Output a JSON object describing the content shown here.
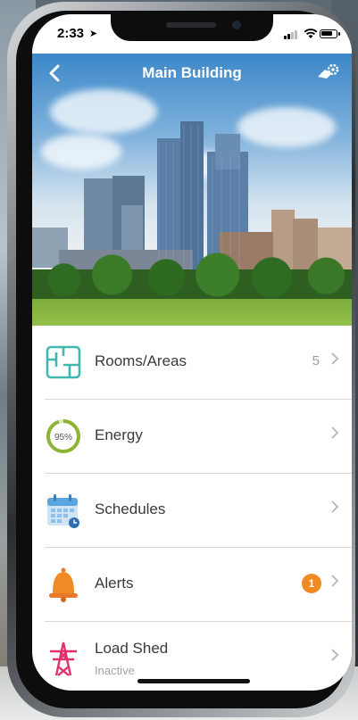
{
  "status_bar": {
    "time": "2:33"
  },
  "header": {
    "title": "Main Building"
  },
  "menu": [
    {
      "id": "rooms",
      "label": "Rooms/Areas",
      "count": "5",
      "icon": "floorplan-icon"
    },
    {
      "id": "energy",
      "label": "Energy",
      "gauge_text": "95%",
      "gauge_value": 95,
      "icon": "energy-gauge-icon"
    },
    {
      "id": "schedules",
      "label": "Schedules",
      "icon": "calendar-icon"
    },
    {
      "id": "alerts",
      "label": "Alerts",
      "badge": "1",
      "icon": "bell-icon"
    },
    {
      "id": "loadshed",
      "label": "Load Shed",
      "sublabel": "Inactive",
      "icon": "power-tower-icon"
    }
  ],
  "colors": {
    "teal": "#3fb8af",
    "energy_green": "#8cb435",
    "schedule_blue": "#5aa6de",
    "alert_orange": "#f08a24",
    "loadshed_pink": "#e0316d"
  }
}
